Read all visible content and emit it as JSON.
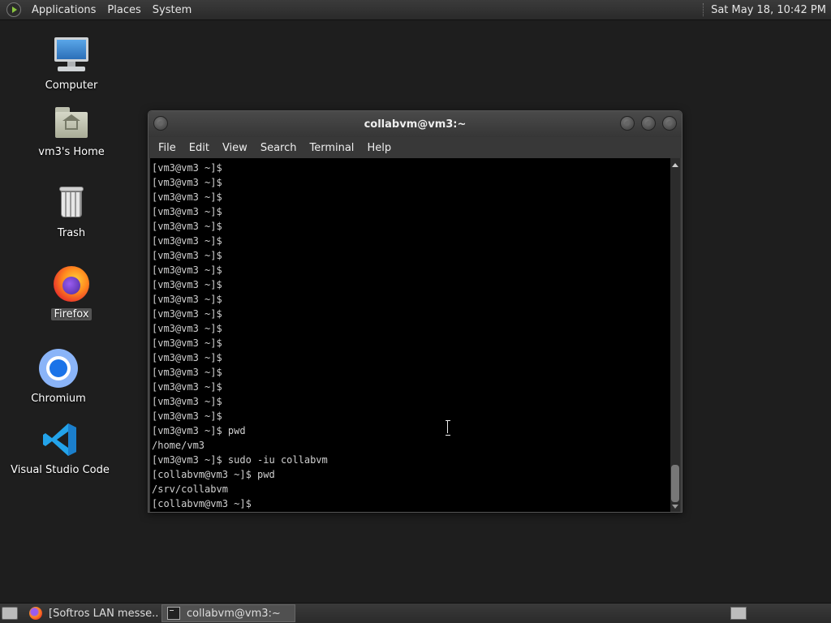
{
  "top_panel": {
    "menus": [
      "Applications",
      "Places",
      "System"
    ],
    "clock": "Sat May 18, 10:42 PM"
  },
  "desktop_icons": {
    "computer": "Computer",
    "home": "vm3's Home",
    "trash": "Trash",
    "firefox": "Firefox",
    "chromium": "Chromium",
    "vscode": "Visual Studio Code"
  },
  "terminal": {
    "title": "collabvm@vm3:~",
    "menu": [
      "File",
      "Edit",
      "View",
      "Search",
      "Terminal",
      "Help"
    ],
    "lines": [
      "[vm3@vm3 ~]$",
      "[vm3@vm3 ~]$",
      "[vm3@vm3 ~]$",
      "[vm3@vm3 ~]$",
      "[vm3@vm3 ~]$",
      "[vm3@vm3 ~]$",
      "[vm3@vm3 ~]$",
      "[vm3@vm3 ~]$",
      "[vm3@vm3 ~]$",
      "[vm3@vm3 ~]$",
      "[vm3@vm3 ~]$",
      "[vm3@vm3 ~]$",
      "[vm3@vm3 ~]$",
      "[vm3@vm3 ~]$",
      "[vm3@vm3 ~]$",
      "[vm3@vm3 ~]$",
      "[vm3@vm3 ~]$",
      "[vm3@vm3 ~]$",
      "[vm3@vm3 ~]$ pwd",
      "/home/vm3",
      "[vm3@vm3 ~]$ sudo -iu collabvm",
      "[collabvm@vm3 ~]$ pwd",
      "/srv/collabvm",
      "[collabvm@vm3 ~]$"
    ]
  },
  "taskbar": {
    "tasks": [
      "[Softros LAN messe...",
      "collabvm@vm3:~"
    ]
  }
}
